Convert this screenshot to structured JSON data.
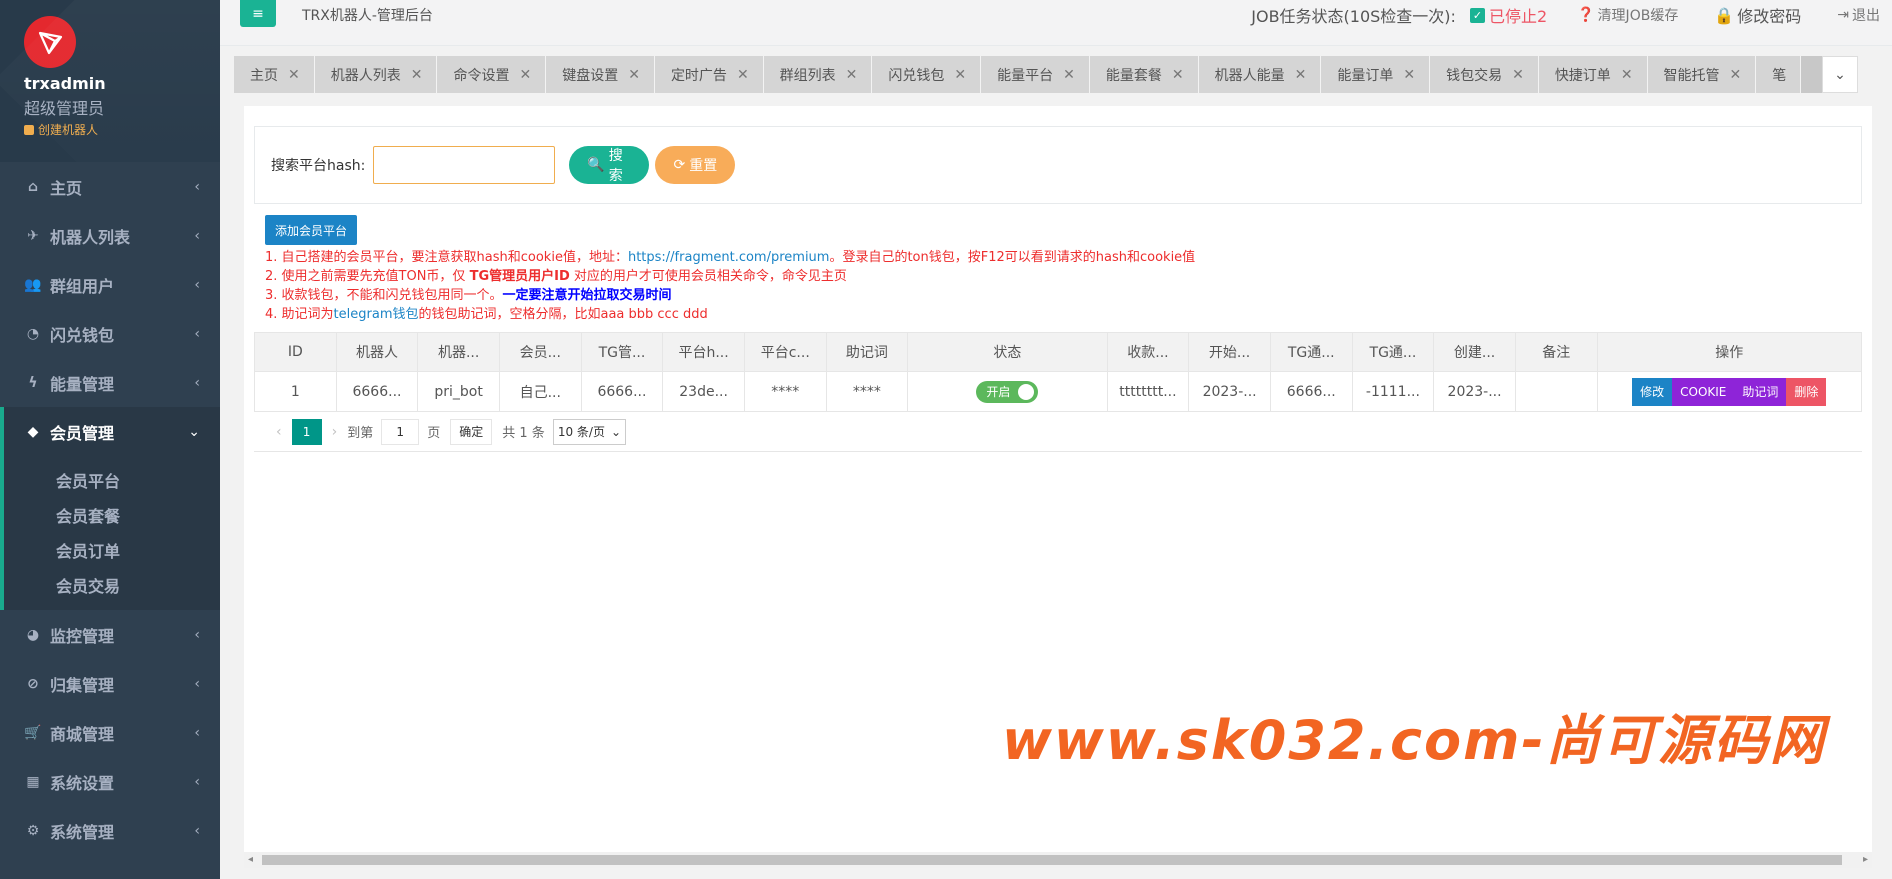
{
  "user": {
    "name": "trxadmin",
    "role": "超级管理员",
    "create_bot": "创建机器人"
  },
  "nav": [
    {
      "label": "主页",
      "icon": "home-icon",
      "glyph": "⌂"
    },
    {
      "label": "机器人列表",
      "icon": "plane-icon",
      "glyph": "✈"
    },
    {
      "label": "群组用户",
      "icon": "users-icon",
      "glyph": "👥"
    },
    {
      "label": "闪兑钱包",
      "icon": "gauge-icon",
      "glyph": "◔"
    },
    {
      "label": "能量管理",
      "icon": "bolt-icon",
      "glyph": "ϟ"
    },
    {
      "label": "会员管理",
      "icon": "diamond-icon",
      "glyph": "◆"
    },
    {
      "label": "监控管理",
      "icon": "pie-icon",
      "glyph": "◕"
    },
    {
      "label": "归集管理",
      "icon": "compass-icon",
      "glyph": "⊘"
    },
    {
      "label": "商城管理",
      "icon": "cart-icon",
      "glyph": "🛒"
    },
    {
      "label": "系统设置",
      "icon": "windows-icon",
      "glyph": "▦"
    },
    {
      "label": "系统管理",
      "icon": "gear-icon",
      "glyph": "⚙"
    }
  ],
  "sub_nav": [
    "会员平台",
    "会员套餐",
    "会员订单",
    "会员交易"
  ],
  "topbar": {
    "title": "TRX机器人-管理后台",
    "job_label": "JOB任务状态(10S检查一次):",
    "job_status": "已停止2",
    "clear_cache": "清理JOB缓存",
    "change_pwd": "修改密码",
    "logout": "退出"
  },
  "tabs": [
    "主页",
    "机器人列表",
    "命令设置",
    "键盘设置",
    "定时广告",
    "群组列表",
    "闪兑钱包",
    "能量平台",
    "能量套餐",
    "机器人能量",
    "能量订单",
    "钱包交易",
    "快捷订单",
    "智能托管",
    "笔"
  ],
  "search": {
    "label": "搜索平台hash:",
    "value": "",
    "search_btn": "搜索",
    "reset_btn": "重置"
  },
  "add_button": "添加会员平台",
  "notes": {
    "n1_a": "1. 自己搭建的会员平台，要注意获取hash和cookie值，地址：",
    "n1_link": "https://fragment.com/premium",
    "n1_b": "。登录自己的ton钱包，按F12可以看到请求的hash和cookie值",
    "n2_a": "2. 使用之前需要先充值TON币，仅 ",
    "n2_b": "TG管理员用户ID",
    "n2_c": " 对应的用户才可使用会员相关命令，命令见主页",
    "n3_a": "3. 收款钱包，不能和闪兑钱包用同一个。",
    "n3_b": "一定要注意开始拉取交易时间",
    "n4_a": "4. 助记词为",
    "n4_link": "telegram钱包",
    "n4_b": "的钱包助记词，空格分隔，比如aaa bbb ccc ddd"
  },
  "table": {
    "headers": [
      "ID",
      "机器人",
      "机器...",
      "会员...",
      "TG管...",
      "平台h...",
      "平台c...",
      "助记词",
      "状态",
      "收款...",
      "开始...",
      "TG通...",
      "TG通...",
      "创建...",
      "备注",
      "操作"
    ],
    "row": [
      "1",
      "6666...",
      "pri_bot",
      "自己...",
      "6666...",
      "23de...",
      "****",
      "****",
      "",
      "tttttttt...",
      "2023-...",
      "6666...",
      "-1111...",
      "2023-...",
      ""
    ],
    "status_label": "开启",
    "ops": {
      "edit": "修改",
      "cookie": "COOKIE",
      "mnemonic": "助记词",
      "delete": "删除"
    }
  },
  "pager": {
    "current": "1",
    "goto_label": "到第",
    "goto_value": "1",
    "page_unit": "页",
    "confirm": "确定",
    "total": "共 1 条",
    "page_size": "10 条/页"
  },
  "watermark": "www.sk032.com-尚可源码网"
}
